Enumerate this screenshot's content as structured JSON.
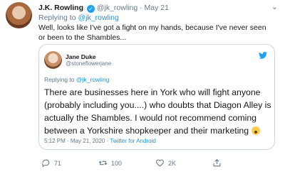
{
  "tweet": {
    "name": "J.K. Rowling",
    "handle": "@jk_rowling",
    "separator": "·",
    "date": "May 21",
    "replying_prefix": "Replying to ",
    "replying_to": "@jk_rowling",
    "text": "Well, looks like I've got a fight on my hands, because I've never seen or been to the Shambles...",
    "quote": {
      "name": "Jane Duke",
      "handle": "@stoneflowerjane",
      "replying_prefix": "Replying to ",
      "replying_to": "@jk_rowling",
      "text": "There are businesses here in York who will fight anyone (probably including you....) who doubts that Diagon Alley is actually the Shambles. I would not recommend coming between a Yorkshire shopkeeper and their marketing",
      "emoji": "hushed-face",
      "time": "5:12 PM · May 21, 2020 · ",
      "source": "Twitter for Android"
    },
    "actions": {
      "replies": "71",
      "retweets": "100",
      "likes": "2K"
    },
    "colors": {
      "accent": "#1da1f2",
      "muted": "#657786",
      "border": "#ccd6dd"
    }
  }
}
